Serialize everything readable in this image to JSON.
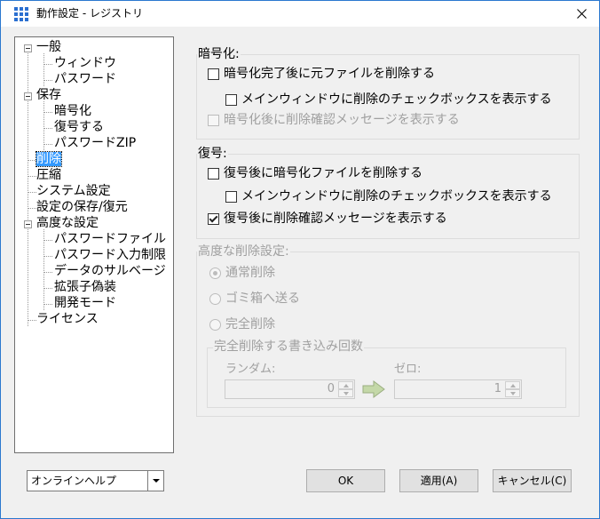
{
  "window": {
    "title": "動作設定 - レジストリ"
  },
  "tree": {
    "items": [
      {
        "label": "一般"
      },
      {
        "label": "ウィンドウ"
      },
      {
        "label": "パスワード"
      },
      {
        "label": "保存"
      },
      {
        "label": "暗号化"
      },
      {
        "label": "復号する"
      },
      {
        "label": "パスワードZIP"
      },
      {
        "label": "削除"
      },
      {
        "label": "圧縮"
      },
      {
        "label": "システム設定"
      },
      {
        "label": "設定の保存/復元"
      },
      {
        "label": "高度な設定"
      },
      {
        "label": "パスワードファイル"
      },
      {
        "label": "パスワード入力制限"
      },
      {
        "label": "データのサルベージ"
      },
      {
        "label": "拡張子偽装"
      },
      {
        "label": "開発モード"
      },
      {
        "label": "ライセンス"
      }
    ],
    "selected": "削除"
  },
  "encryption": {
    "title": "暗号化:",
    "delete_original": {
      "label": "暗号化完了後に元ファイルを削除する",
      "checked": false
    },
    "show_checkbox": {
      "label": "メインウィンドウに削除のチェックボックスを表示する",
      "checked": false
    },
    "confirm_message": {
      "label": "暗号化後に削除確認メッセージを表示する",
      "checked": false
    }
  },
  "decryption": {
    "title": "復号:",
    "delete_encrypted": {
      "label": "復号後に暗号化ファイルを削除する",
      "checked": false
    },
    "show_checkbox": {
      "label": "メインウィンドウに削除のチェックボックスを表示する",
      "checked": false
    },
    "confirm_message": {
      "label": "復号後に削除確認メッセージを表示する",
      "checked": true
    }
  },
  "advanced_delete": {
    "title": "高度な削除設定:",
    "options": [
      {
        "label": "通常削除",
        "selected": true
      },
      {
        "label": "ゴミ箱へ送る",
        "selected": false
      },
      {
        "label": "完全削除",
        "selected": false
      }
    ],
    "overwrite": {
      "title": "完全削除する書き込み回数",
      "random_label": "ランダム:",
      "random_value": "0",
      "zero_label": "ゼロ:",
      "zero_value": "1"
    }
  },
  "footer": {
    "help_combo": "オンラインヘルプ",
    "ok": "OK",
    "apply": "適用(A)",
    "cancel": "キャンセル(C)"
  },
  "colors": {
    "accent": "#3399ff",
    "border": "#2b78cf"
  }
}
